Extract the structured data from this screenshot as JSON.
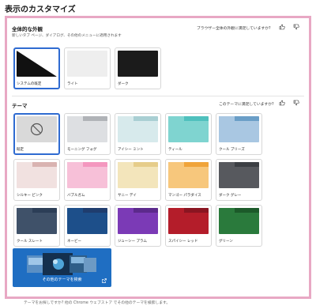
{
  "page": {
    "title": "表示のカスタマイズ"
  },
  "appearance": {
    "title": "全体的な外観",
    "subtitle": "新しいタブ ページ、ダイアログ、その他のメニューに適用されます",
    "feedback": "ブラウザー全体の外観に満足していますか?",
    "options": [
      {
        "label": "システムの既定",
        "selected": true
      },
      {
        "label": "ライト",
        "selected": false
      },
      {
        "label": "ダーク",
        "selected": false
      }
    ]
  },
  "theme": {
    "title": "テーマ",
    "feedback": "このテーマに満足していますか?",
    "options": [
      {
        "label": "既定",
        "selected": true,
        "colors": {
          "tab": "#d9d9d9",
          "body": "#d9d9d9"
        }
      },
      {
        "label": "モーニング フォグ",
        "selected": false,
        "colors": {
          "tab": "#b0b3b7",
          "body": "#dddfe2"
        }
      },
      {
        "label": "アイシー ミント",
        "selected": false,
        "colors": {
          "tab": "#a9cfd3",
          "body": "#d7eaec"
        }
      },
      {
        "label": "ティール",
        "selected": false,
        "colors": {
          "tab": "#4fc0bd",
          "body": "#7fd4d0"
        }
      },
      {
        "label": "クール ブリーズ",
        "selected": false,
        "colors": {
          "tab": "#6a9ec7",
          "body": "#a9c7e2"
        }
      },
      {
        "label": "シルキー ピンク",
        "selected": false,
        "colors": {
          "tab": "#d9b3b1",
          "body": "#f1e1e0"
        }
      },
      {
        "label": "バブルガム",
        "selected": false,
        "colors": {
          "tab": "#f497bf",
          "body": "#f7c0d8"
        }
      },
      {
        "label": "サニー デイ",
        "selected": false,
        "colors": {
          "tab": "#e6cd8a",
          "body": "#f3e5bb"
        }
      },
      {
        "label": "マンゴー パラダイス",
        "selected": false,
        "colors": {
          "tab": "#f0a43a",
          "body": "#f7c77c"
        }
      },
      {
        "label": "ダーク グレー",
        "selected": false,
        "colors": {
          "tab": "#3c3f44",
          "body": "#57595e"
        }
      },
      {
        "label": "クール スレート",
        "selected": false,
        "colors": {
          "tab": "#2c3e57",
          "body": "#3f5169"
        }
      },
      {
        "label": "ネービー",
        "selected": false,
        "colors": {
          "tab": "#1f3d6e",
          "body": "#1d4f8a"
        }
      },
      {
        "label": "ジューシー プラム",
        "selected": false,
        "colors": {
          "tab": "#5c2a8c",
          "body": "#7b3ab6"
        }
      },
      {
        "label": "スパイシー レッド",
        "selected": false,
        "colors": {
          "tab": "#8a1521",
          "body": "#b41d2a"
        }
      },
      {
        "label": "グリーン",
        "selected": false,
        "colors": {
          "tab": "#1c5a2a",
          "body": "#2a7a3c"
        }
      }
    ]
  },
  "explore": {
    "label": "その他のテーマを検索"
  },
  "footer": {
    "text": "テーマをお探しですか? 他の Chrome ウェブストア でその他のテーマを検索します。",
    "link": "Chrome ウェブストア"
  },
  "colors": {
    "accent": "#2f6bd1",
    "frame": "#e8a8c4",
    "explore_bg": "#1f6ec2"
  }
}
